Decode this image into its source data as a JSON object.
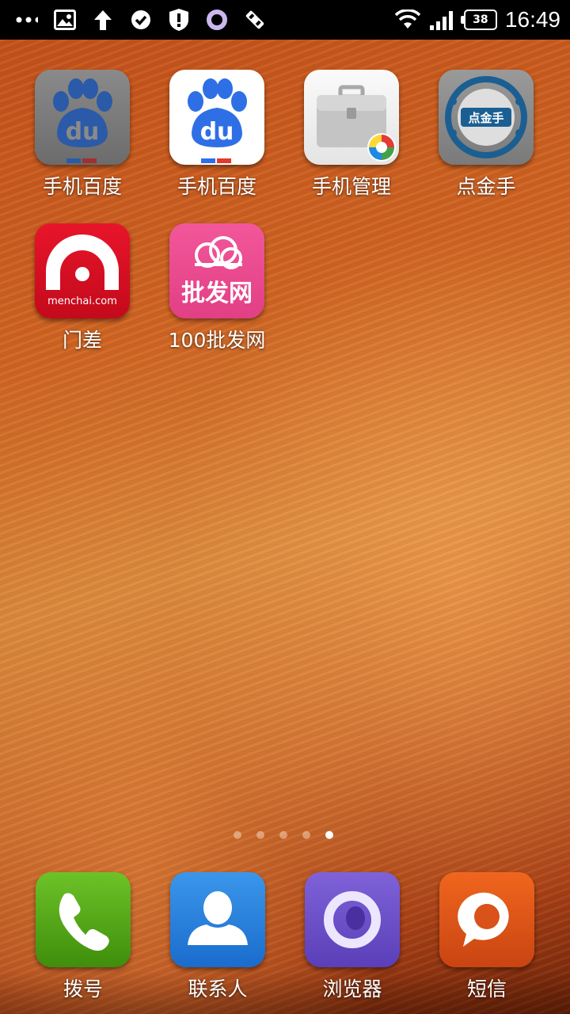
{
  "status_bar": {
    "time": "16:49",
    "battery": "38",
    "left_icons": [
      "more-dots-icon",
      "image-icon",
      "upload-arrow-icon",
      "check-circle-icon",
      "shield-alert-icon",
      "ring-icon",
      "tool-icon"
    ],
    "right_icons": [
      "wifi-icon",
      "signal-icon",
      "battery-icon"
    ]
  },
  "apps": [
    {
      "label": "手机百度",
      "icon": "baidu-gray-icon",
      "text": "du"
    },
    {
      "label": "手机百度",
      "icon": "baidu-icon",
      "text": "du"
    },
    {
      "label": "手机管理",
      "icon": "toolbox-icon"
    },
    {
      "label": "点金手",
      "icon": "dianjinshou-icon",
      "text": "点金手"
    },
    {
      "label": "门差",
      "icon": "menchai-icon",
      "text": "menchai.com"
    },
    {
      "label": "100批发网",
      "icon": "pifawang-icon",
      "text": "批发网"
    }
  ],
  "pager": {
    "count": 5,
    "active": 5
  },
  "dock": [
    {
      "label": "拨号",
      "icon": "phone-icon",
      "color": "#4fa214"
    },
    {
      "label": "联系人",
      "icon": "contacts-icon",
      "color": "#1f7fd8"
    },
    {
      "label": "浏览器",
      "icon": "browser-icon",
      "color": "#6a4ec8"
    },
    {
      "label": "短信",
      "icon": "message-icon",
      "color": "#e0531a"
    }
  ]
}
